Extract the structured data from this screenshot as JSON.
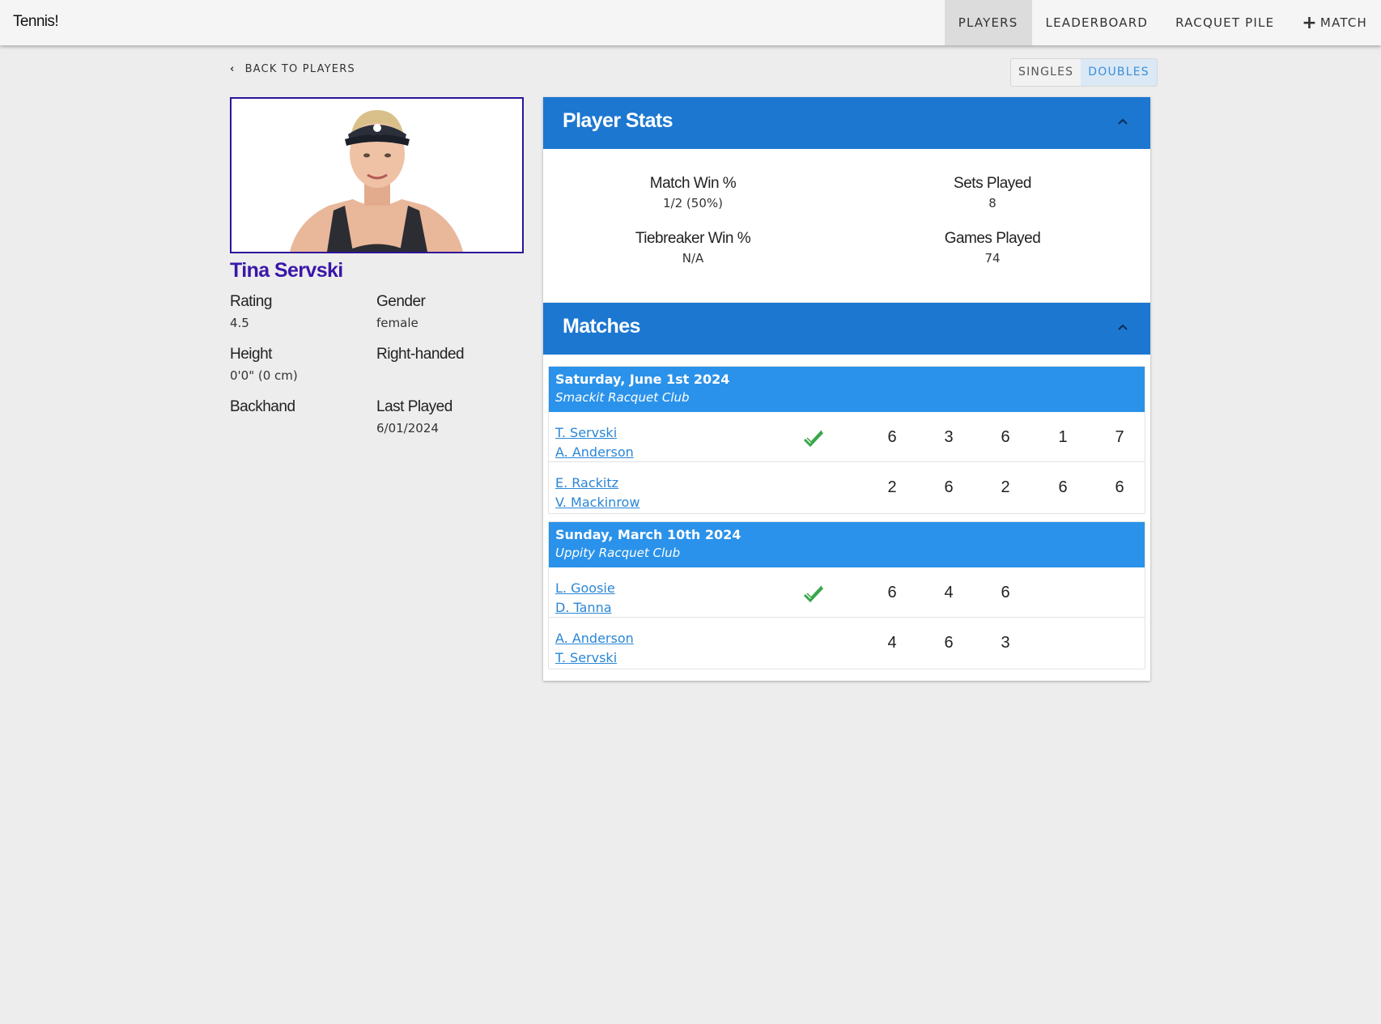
{
  "app": {
    "brand": "Tennis!"
  },
  "nav": {
    "items": [
      {
        "label": "PLAYERS",
        "active": true
      },
      {
        "label": "LEADERBOARD",
        "active": false
      },
      {
        "label": "RACQUET PILE",
        "active": false
      },
      {
        "label": "MATCH",
        "active": false,
        "icon": "plus-icon"
      }
    ]
  },
  "back": {
    "label": "BACK TO PLAYERS",
    "icon": "chevron-left-icon"
  },
  "mode_toggle": {
    "options": [
      "SINGLES",
      "DOUBLES"
    ],
    "selected": "DOUBLES"
  },
  "player": {
    "name": "Tina Servski",
    "fields": [
      {
        "label": "Rating",
        "value": "4.5"
      },
      {
        "label": "Gender",
        "value": "female"
      },
      {
        "label": "Height",
        "value": "0'0\" (0 cm)"
      },
      {
        "label": "Right-handed",
        "value": ""
      },
      {
        "label": "Backhand",
        "value": ""
      },
      {
        "label": "Last Played",
        "value": "6/01/2024"
      }
    ]
  },
  "stats_panel": {
    "title": "Player Stats",
    "stats": [
      {
        "label": "Match Win %",
        "value": "1/2 (50%)"
      },
      {
        "label": "Sets Played",
        "value": "8"
      },
      {
        "label": "Tiebreaker Win %",
        "value": "N/A"
      },
      {
        "label": "Games Played",
        "value": "74"
      }
    ]
  },
  "matches_panel": {
    "title": "Matches",
    "matches": [
      {
        "date": "Saturday, June 1st 2024",
        "club": "Smackit Racquet Club",
        "teams": [
          {
            "players": [
              "T. Servski",
              "A. Anderson"
            ],
            "winner": true,
            "scores": [
              "6",
              "3",
              "6",
              "1",
              "7"
            ]
          },
          {
            "players": [
              "E. Rackitz",
              "V. Mackinrow"
            ],
            "winner": false,
            "scores": [
              "2",
              "6",
              "2",
              "6",
              "6"
            ]
          }
        ]
      },
      {
        "date": "Sunday, March 10th 2024",
        "club": "Uppity Racquet Club",
        "teams": [
          {
            "players": [
              "L. Goosie",
              "D. Tanna"
            ],
            "winner": true,
            "scores": [
              "6",
              "4",
              "6"
            ]
          },
          {
            "players": [
              "A. Anderson",
              "T. Servski"
            ],
            "winner": false,
            "scores": [
              "4",
              "6",
              "3"
            ]
          }
        ]
      }
    ]
  },
  "colors": {
    "header_blue": "#1c77d0",
    "match_header_blue": "#2a92ea",
    "link_blue": "#2a86d6",
    "player_name": "#3a17a8",
    "win_check": "#3aa64a"
  }
}
